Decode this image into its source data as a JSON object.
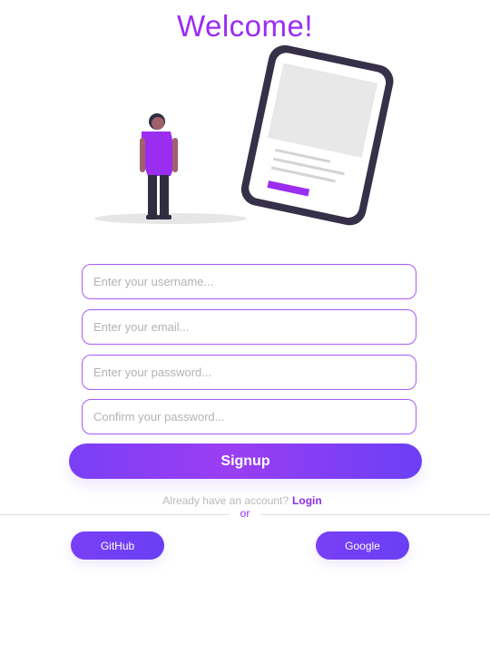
{
  "header": {
    "title": "Welcome!"
  },
  "illustration": {
    "icon": "person-with-phone-illustration",
    "accent_color": "#9b2df0",
    "dark_color": "#363048"
  },
  "form": {
    "username_placeholder": "Enter your username...",
    "email_placeholder": "Enter your email...",
    "password_placeholder": "Enter your password...",
    "confirm_placeholder": "Confirm your password...",
    "signup_label": "Signup"
  },
  "login_prompt": {
    "text": "Already have an account?",
    "link_label": "Login"
  },
  "divider": {
    "label": "or"
  },
  "social": {
    "github_label": "GitHub",
    "google_label": "Google"
  },
  "colors": {
    "accent": "#9a2cf5",
    "button_gradient_start": "#7a3ff6",
    "button_gradient_end": "#6b3ff6"
  }
}
